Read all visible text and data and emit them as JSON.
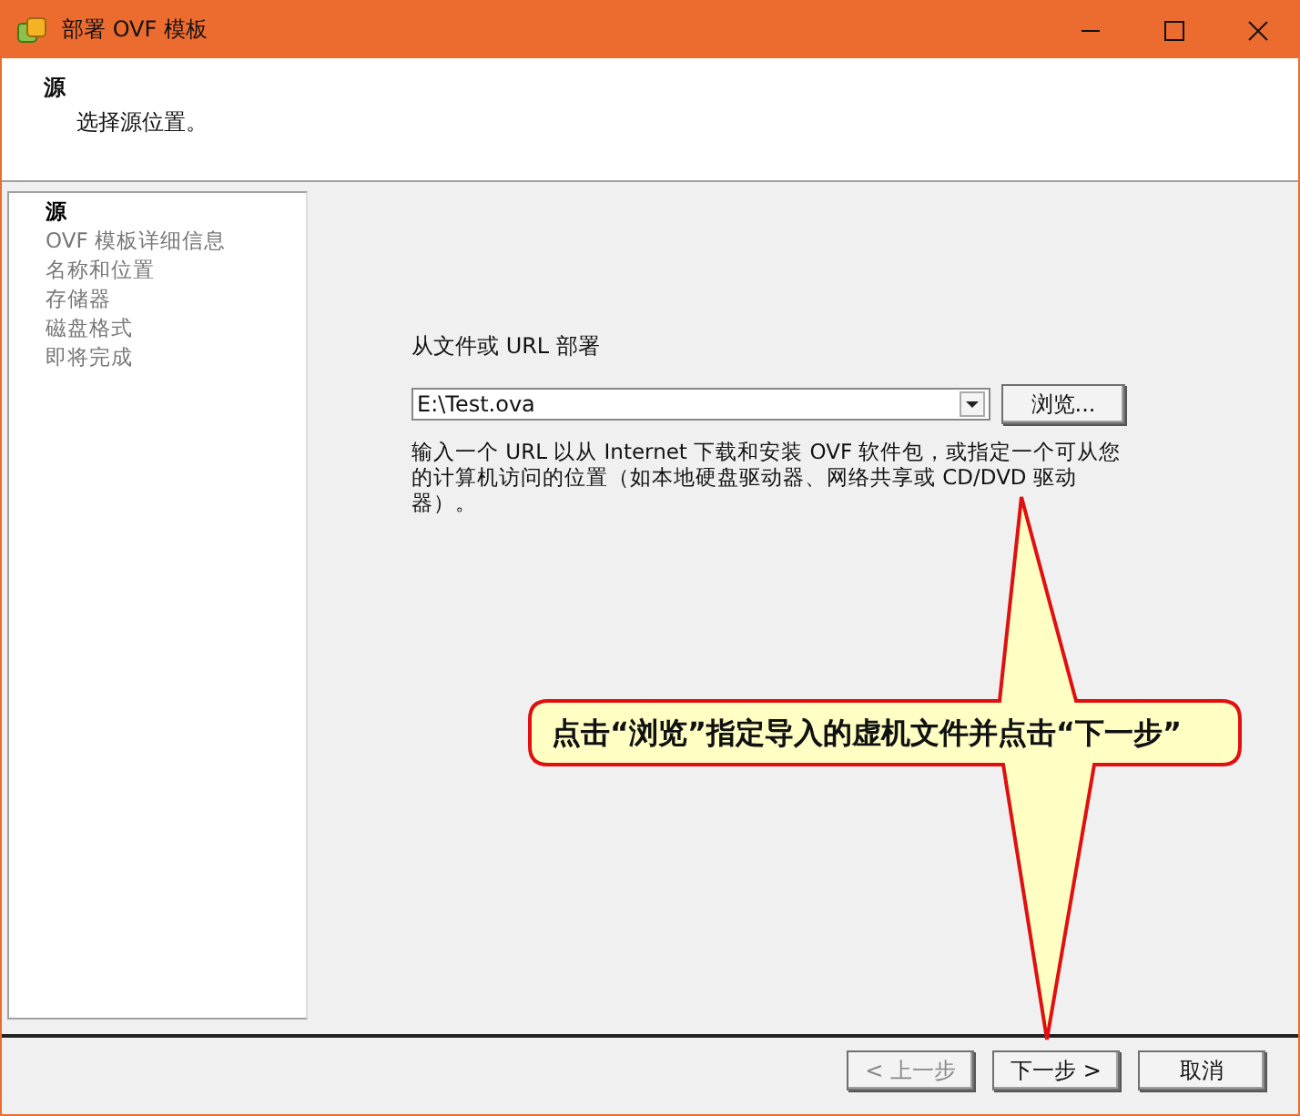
{
  "window": {
    "title": "部署 OVF 模板"
  },
  "header": {
    "title": "源",
    "subtitle": "选择源位置。"
  },
  "steps": [
    {
      "label": "源",
      "selected": true
    },
    {
      "label": "OVF 模板详细信息",
      "selected": false
    },
    {
      "label": "名称和位置",
      "selected": false
    },
    {
      "label": "存储器",
      "selected": false
    },
    {
      "label": "磁盘格式",
      "selected": false
    },
    {
      "label": "即将完成",
      "selected": false
    }
  ],
  "source": {
    "label": "从文件或 URL 部署",
    "value": "E:\\Test.ova",
    "browse": "浏览...",
    "help": "输入一个 URL 以从 Internet 下载和安装 OVF 软件包，或指定一个可从您的计算机访问的位置（如本地硬盘驱动器、网络共享或 CD/DVD 驱动器）。"
  },
  "callout": {
    "text": "点击“浏览”指定导入的虚机文件并点击“下一步”"
  },
  "buttons": [
    {
      "label": "< 上一步",
      "disabled": true
    },
    {
      "label": "下一步 >",
      "disabled": false
    },
    {
      "label": "取消",
      "disabled": false
    }
  ]
}
